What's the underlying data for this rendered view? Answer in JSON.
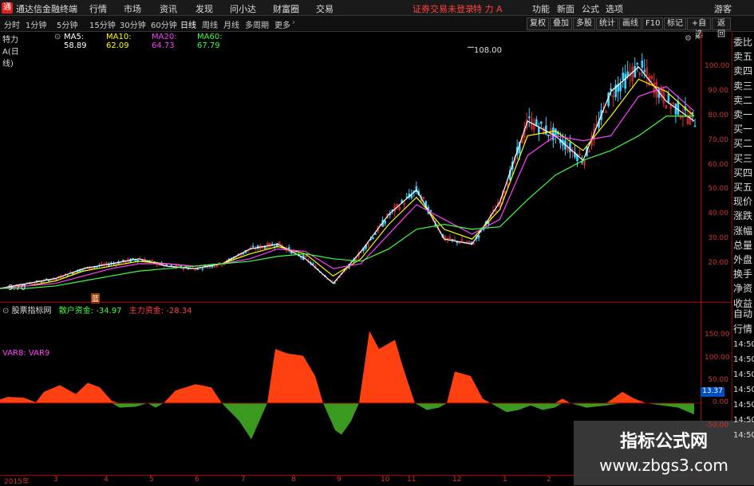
{
  "titlebar": {
    "app_name": "通达信金融终端",
    "menus": [
      "行情",
      "市场",
      "资讯",
      "发现",
      "问小达",
      "财富圈",
      "交易"
    ],
    "warning": "证券交易未登录",
    "stock_title": "特 力 A",
    "right_menus": [
      "功能",
      "新面",
      "公式",
      "选项"
    ],
    "user": "游客"
  },
  "toolbar": {
    "periods": [
      "分时",
      "1分钟",
      "5分钟",
      "15分钟",
      "30分钟",
      "60分钟",
      "日线",
      "周线",
      "月线",
      "多周期",
      "更多"
    ],
    "active_period": "日线",
    "right_buttons": [
      "复权",
      "叠加",
      "多股",
      "统计",
      "画线",
      "F10",
      "标记",
      "+自选",
      "返回"
    ]
  },
  "main_chart": {
    "stock_label": "特力A(日线)",
    "ma": [
      {
        "name": "MA5",
        "value": "58.89",
        "color": "#ffffff"
      },
      {
        "name": "MA10",
        "value": "62.09",
        "color": "#ffff00"
      },
      {
        "name": "MA20",
        "value": "64.73",
        "color": "#ff40ff"
      },
      {
        "name": "MA60",
        "value": "67.79",
        "color": "#40ff40"
      }
    ],
    "high_label": "108.00",
    "low_label": "9.70",
    "marker": "蓝"
  },
  "sub_chart": {
    "title": "股票指标网",
    "retail_label": "散户资金:",
    "retail_value": "-34.97",
    "main_label": "主力资金:",
    "main_value": "-28.34",
    "var_label": "VAR8: VAR9",
    "current_value": "13.37"
  },
  "right_panel": [
    "委比",
    "卖五",
    "卖四",
    "卖三",
    "卖二",
    "卖一",
    "买一",
    "买二",
    "买三",
    "买四",
    "买五",
    "现价",
    "涨跌",
    "涨幅",
    "总量",
    "外盘",
    "换手",
    "净资",
    "收益",
    "自动",
    "行情",
    "14:50",
    "14:50",
    "14:50",
    "14:50",
    "14:50",
    "14:50",
    "14:50"
  ],
  "y_axis_main": [
    "100.00",
    "90.00",
    "80.00",
    "70.00",
    "60.00",
    "50.00",
    "40.00",
    "30.00",
    "20.00"
  ],
  "y_axis_sub": [
    "150.00",
    "100.00",
    "50.00",
    "0.00",
    "-50.00"
  ],
  "x_axis": [
    "2015年",
    "3",
    "4",
    "5",
    "6",
    "7",
    "8",
    "9",
    "10",
    "11",
    "12",
    "1",
    "2"
  ],
  "watermark": {
    "line1": "指标公式网",
    "line2": "www.zbgs3.com"
  },
  "chart_data": {
    "type": "line",
    "x": [
      0,
      10,
      20,
      30,
      40,
      50,
      60,
      70,
      80,
      90,
      100,
      110,
      120,
      130,
      140,
      150,
      160,
      170,
      180,
      190,
      200,
      210,
      220,
      230,
      240,
      250
    ],
    "series": [
      {
        "name": "MA5",
        "values": [
          10,
          12,
          14,
          18,
          20,
          22,
          19,
          18,
          20,
          26,
          28,
          22,
          12,
          25,
          40,
          50,
          30,
          28,
          45,
          78,
          72,
          62,
          90,
          100,
          86,
          78
        ]
      },
      {
        "name": "MA10",
        "values": [
          10,
          11,
          13,
          17,
          19,
          21,
          20,
          19,
          20,
          24,
          27,
          24,
          15,
          22,
          36,
          47,
          34,
          30,
          42,
          72,
          74,
          66,
          80,
          95,
          90,
          80
        ]
      },
      {
        "name": "MA20",
        "values": [
          10,
          11,
          12,
          15,
          18,
          20,
          20,
          19,
          20,
          22,
          26,
          25,
          18,
          20,
          32,
          44,
          38,
          32,
          38,
          64,
          72,
          70,
          72,
          88,
          92,
          82
        ]
      },
      {
        "name": "MA60",
        "values": [
          10,
          10,
          11,
          13,
          15,
          17,
          18,
          19,
          20,
          21,
          23,
          24,
          22,
          21,
          26,
          34,
          36,
          34,
          35,
          46,
          56,
          62,
          66,
          72,
          80,
          80
        ]
      }
    ],
    "ylim": [
      0,
      110
    ]
  }
}
